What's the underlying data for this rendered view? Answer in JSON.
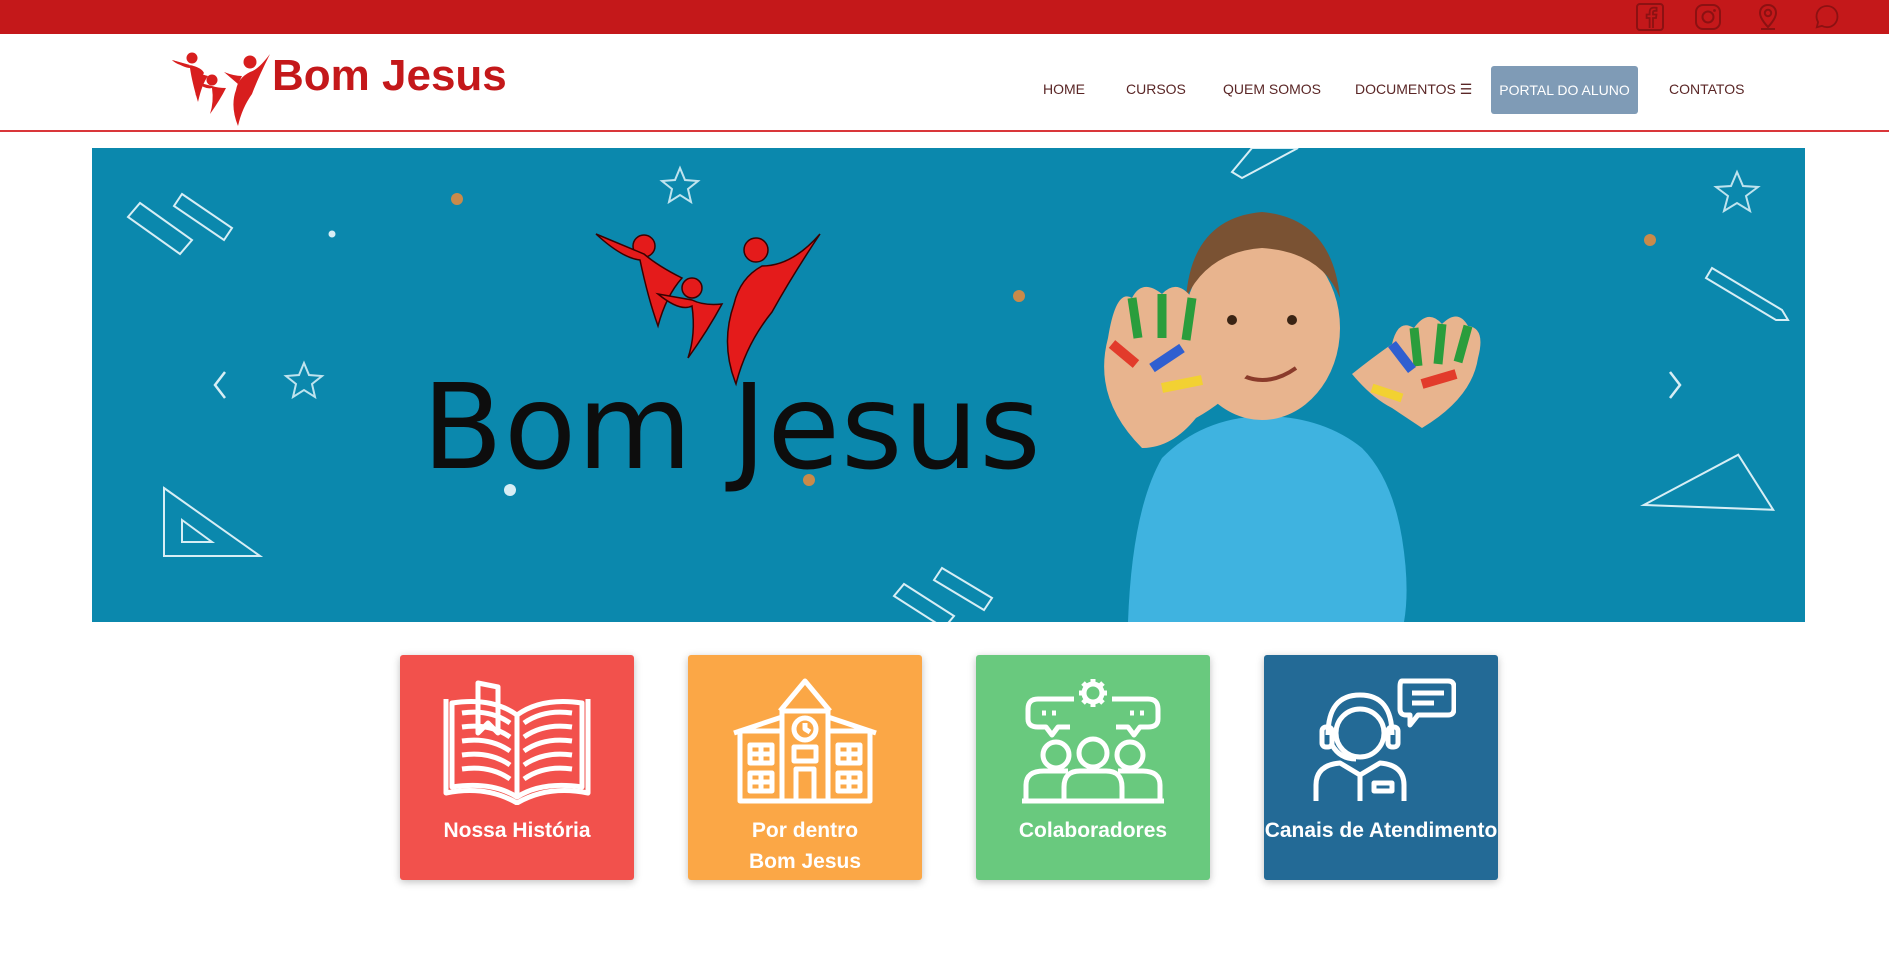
{
  "colors": {
    "topbar": "#c4181a",
    "brand_red": "#c4181a",
    "banner_bg": "#0b88ad",
    "portal_button": "#7f9bb6",
    "card_historia": "#f2514c",
    "card_dentro": "#fba746",
    "card_colab": "#69c97e",
    "card_canais": "#236a96"
  },
  "social": [
    {
      "icon": "facebook-icon"
    },
    {
      "icon": "instagram-icon"
    },
    {
      "icon": "map-pin-icon"
    },
    {
      "icon": "whatsapp-icon"
    }
  ],
  "header": {
    "logo_text": "Bom Jesus"
  },
  "nav": {
    "home": "HOME",
    "cursos": "CURSOS",
    "quem_somos": "QUEM SOMOS",
    "documentos": "DOCUMENTOS ☰",
    "portal": "PORTAL DO ALUNO",
    "contatos": "CONTATOS"
  },
  "banner": {
    "title": "Bom Jesus",
    "prev_icon": "chevron-left-icon",
    "next_icon": "chevron-right-icon"
  },
  "cards": {
    "historia": {
      "label": "Nossa História",
      "icon": "open-book-icon"
    },
    "dentro": {
      "label_line1": "Por dentro",
      "label_line2": "Bom Jesus",
      "icon": "school-building-icon"
    },
    "colab": {
      "label": "Colaboradores",
      "icon": "team-icon"
    },
    "canais": {
      "label": "Canais de Atendimento",
      "icon": "support-agent-icon"
    }
  }
}
